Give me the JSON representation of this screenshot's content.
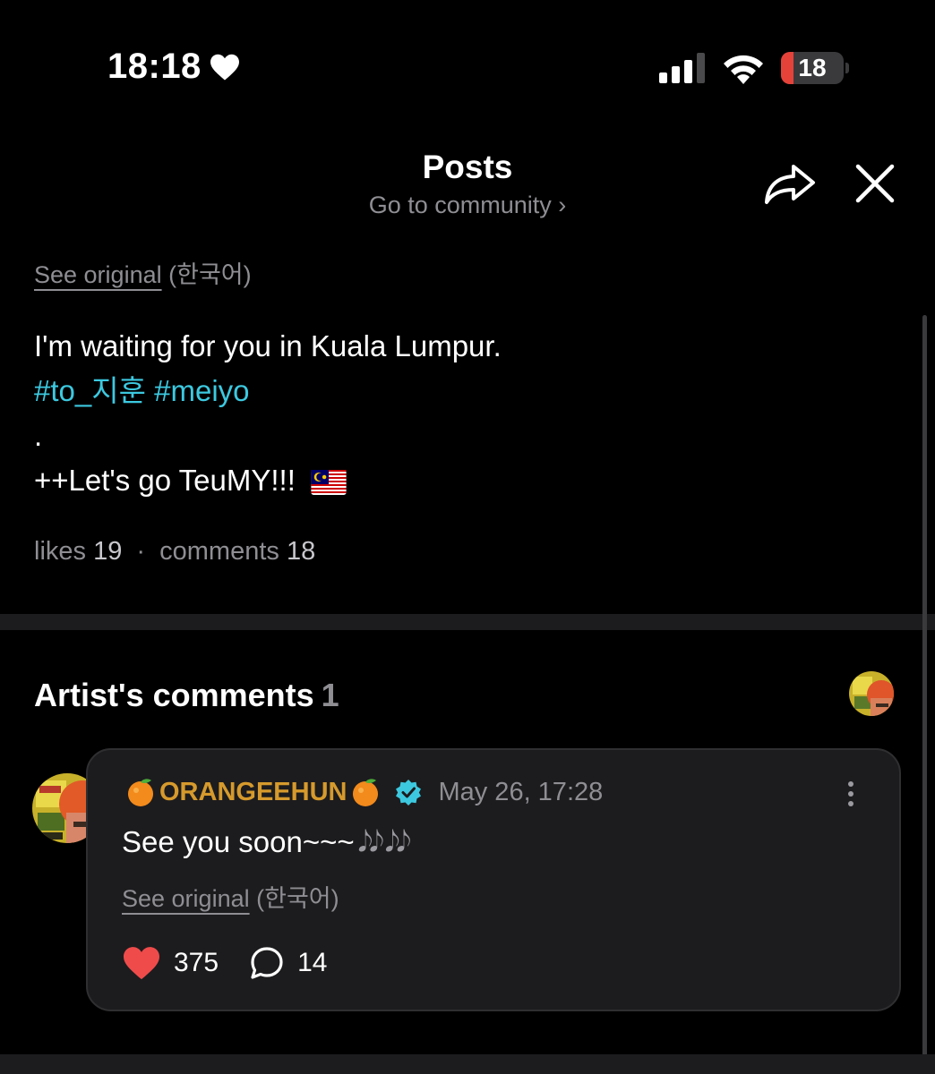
{
  "status_bar": {
    "time": "18:18",
    "battery_level": "18",
    "icons": [
      "heart-icon",
      "signal-icon",
      "wifi-icon",
      "battery-icon"
    ]
  },
  "header": {
    "title": "Posts",
    "subtitle": "Go to community",
    "subtitle_chevron": "›"
  },
  "post": {
    "see_original": "See original",
    "language": "(한국어)",
    "line1": "I'm waiting for you in Kuala Lumpur.",
    "hashtags": [
      "#to_지훈",
      "#meiyo"
    ],
    "line3": ".",
    "line4": "++Let's go TeuMY!!!",
    "flag_icon": "malaysia-flag-icon",
    "likes_label": "likes",
    "likes_count": "19",
    "separator": "·",
    "comments_label": "comments",
    "comments_count": "18"
  },
  "artist_comments": {
    "title": "Artist's comments",
    "count": "1",
    "comment": {
      "username": "ORANGEEHUN",
      "date": "May 26, 17:28",
      "text": "See you soon~~~",
      "notes": "𝅘𝅥𝅮𝅘𝅥𝅮 𝅘𝅥𝅮𝅘𝅥𝅮",
      "see_original": "See original",
      "language": "(한국어)",
      "likes": "375",
      "replies": "14"
    }
  },
  "colors": {
    "background": "#000000",
    "hashtag": "#3cc9e0",
    "username": "#d69a2c",
    "heart": "#ef4b4b",
    "verified": "#3cc9e0",
    "muted": "#8e8e93",
    "card": "#1c1c1e"
  }
}
